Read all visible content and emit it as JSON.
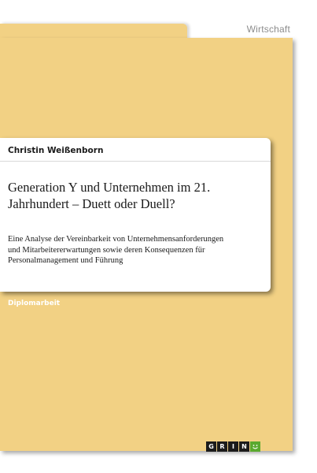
{
  "category": "Wirtschaft",
  "author": "Christin Weißenborn",
  "title_line1": "Generation Y und Unternehmen im 21.",
  "title_line2": "Jahrhundert – Duett oder Duell?",
  "subtitle_line1": "Eine Analyse der Vereinbarkeit von Unternehmensanforderungen",
  "subtitle_line2": "und Mitarbeitererwartungen sowie deren Konsequenzen für",
  "subtitle_line3": "Personalmanagement und Führung",
  "document_type": "Diplomarbeit",
  "publisher_logo": {
    "letters": [
      "G",
      "R",
      "I",
      "N"
    ],
    "smile_icon": "smiley-icon",
    "accent_color": "#5aa92e"
  },
  "colors": {
    "cover": "#f2d184",
    "card": "#ffffff"
  }
}
